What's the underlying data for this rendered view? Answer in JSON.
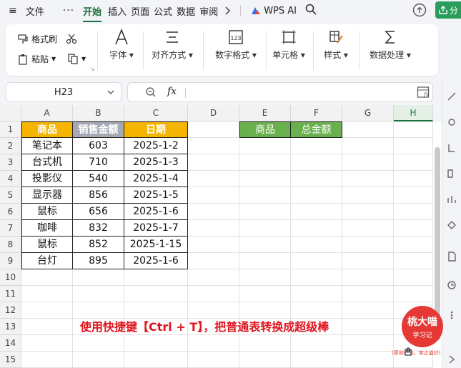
{
  "menubar": {
    "file": "文件",
    "more": "···",
    "tabs": [
      "开始",
      "插入",
      "页面",
      "公式",
      "数据",
      "审阅"
    ],
    "wps_ai": "WPS AI",
    "share": "分"
  },
  "ribbon": {
    "format_painter": "格式刷",
    "paste": "粘贴",
    "font": "字体",
    "align": "对齐方式",
    "number_format": "数字格式",
    "cell": "单元格",
    "style": "样式",
    "data_process": "数据处理"
  },
  "formula_bar": {
    "name_box": "H23",
    "fx": "fx",
    "formula": ""
  },
  "sheet": {
    "columns": [
      "A",
      "B",
      "C",
      "D",
      "E",
      "F",
      "G",
      "H"
    ],
    "rows": [
      "1",
      "2",
      "3",
      "4",
      "5",
      "6",
      "7",
      "8",
      "9",
      "10",
      "11",
      "12",
      "13",
      "14",
      "15"
    ],
    "table_headers": [
      "商品",
      "销售金额",
      "日期"
    ],
    "table_rows": [
      [
        "笔记本",
        "603",
        "2025-1-2"
      ],
      [
        "台式机",
        "710",
        "2025-1-3"
      ],
      [
        "投影仪",
        "540",
        "2025-1-4"
      ],
      [
        "显示器",
        "856",
        "2025-1-5"
      ],
      [
        "鼠标",
        "656",
        "2025-1-6"
      ],
      [
        "咖啡",
        "832",
        "2025-1-7"
      ],
      [
        "鼠标",
        "852",
        "2025-1-15"
      ],
      [
        "台灯",
        "895",
        "2025-1-6"
      ]
    ],
    "summary_headers": [
      "商品",
      "总金额"
    ]
  },
  "caption": "使用快捷键【Ctrl + T】，把普通表转换成超级棒",
  "logo": {
    "line1": "桃大喵",
    "line2": "学习记"
  },
  "watermark": "(原创作品，禁止盗抄)",
  "colors": {
    "gold_header": "#f4b400",
    "gray_header": "#a6a9b4",
    "green_header": "#6ab04c",
    "accent": "#1a6f3a",
    "caption": "#e0141e"
  }
}
